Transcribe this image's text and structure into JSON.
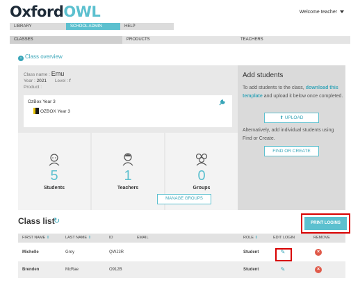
{
  "brand": {
    "logo_prefix": "Oxford",
    "logo_owl": "OWL"
  },
  "user": {
    "welcome": "Welcome teacher"
  },
  "main_nav": [
    {
      "label": "LIBRARY",
      "active": false
    },
    {
      "label": "SCHOOL ADMIN",
      "active": true
    },
    {
      "label": "HELP",
      "active": false
    }
  ],
  "sub_nav": [
    {
      "label": "CLASSES",
      "active": true
    },
    {
      "label": "PRODUCTS",
      "active": false
    },
    {
      "label": "TEACHERS",
      "active": false
    }
  ],
  "breadcrumb": {
    "back_label": "Class overview"
  },
  "class_info": {
    "name_label": "Class name :",
    "name": "Emu",
    "year_label": "Year :",
    "year": "2021",
    "level_label": "Level :",
    "level": "f",
    "product_label": "Product :"
  },
  "product": {
    "name": "OzBox Year 3",
    "sub_name": "OZBOX Year 3"
  },
  "stats": {
    "students": {
      "count": "5",
      "label": "Students"
    },
    "teachers": {
      "count": "1",
      "label": "Teachers"
    },
    "groups": {
      "count": "0",
      "label": "Groups"
    },
    "manage_groups_label": "MANAGE GROUPS"
  },
  "add_students": {
    "title": "Add students",
    "text_before": "To add students to the class,",
    "download_link": "download this template",
    "text_after": "and upload it below once completed.",
    "upload_label": "UPLOAD",
    "alt_text": "Alternatively, add individual students using Find or Create.",
    "find_create_label": "FIND OR CREATE"
  },
  "class_list": {
    "title": "Class list",
    "print_label": "PRINT LOGINS",
    "columns": {
      "first_name": "FIRST NAME",
      "last_name": "LAST NAME",
      "id": "ID",
      "email": "EMAIL",
      "role": "ROLE",
      "edit_login": "EDIT LOGIN",
      "remove": "REMOVE"
    },
    "rows": [
      {
        "first_name": "Michelle",
        "last_name": "Grey",
        "id": "QWJ3R",
        "email": "",
        "role": "Student"
      },
      {
        "first_name": "Brenden",
        "last_name": "McRae",
        "id": "O912B",
        "email": "",
        "role": "Student"
      }
    ]
  },
  "colors": {
    "accent": "#5cc0cf",
    "link": "#3aa6b9",
    "highlight": "#d80000",
    "remove": "#e05a4a"
  }
}
